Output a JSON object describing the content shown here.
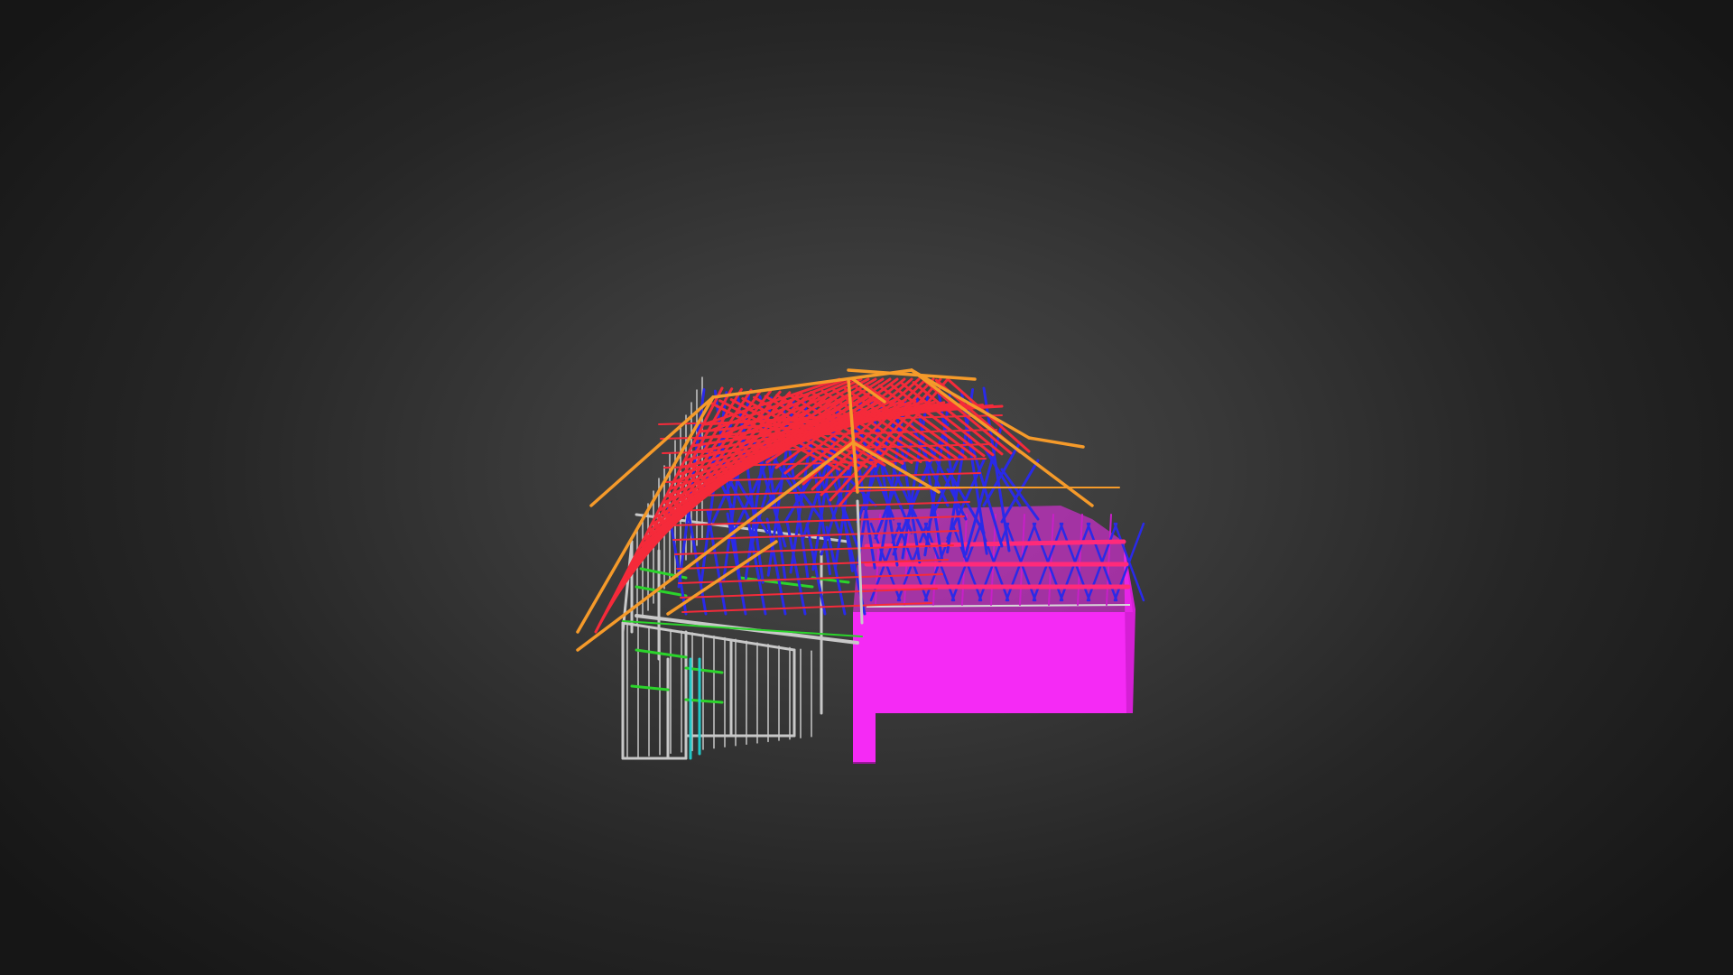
{
  "viewer": {
    "background_center": "#4a4a4a",
    "background_edge": "#161616"
  },
  "model": {
    "name": "",
    "colors": {
      "wall_frame": "#c8c8c8",
      "wall_noggin": "#2bd42b",
      "wall_stud_accent": "#22c8c8",
      "truss_web": "#2a2ae8",
      "rafter": "#f52a3a",
      "ridge_hip": "#f59a2a",
      "garage_fill": "#f52af5",
      "garage_shadow": "#c81fc8"
    }
  }
}
